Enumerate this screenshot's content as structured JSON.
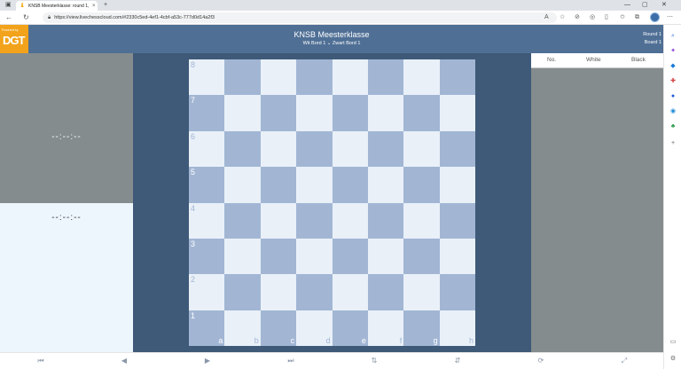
{
  "browser": {
    "tab_title": "KNSB Meesterklasse: round 1, g...",
    "tab_close": "×",
    "new_tab": "+",
    "url": "https://view.livechesscloud.com/#2330c5ed-4ef1-4cbf-a53c-777d0d14a2f3"
  },
  "app": {
    "logo_powered": "Powered by",
    "logo_text": "DGT",
    "title": "KNSB Meesterklasse",
    "subtitle": "Wit Bord 1 ⌄ Zwart Bord 1",
    "round": "Round 1",
    "board": "Board 1"
  },
  "clocks": {
    "top": "--:--:--",
    "bottom": "--:--:--"
  },
  "moves": {
    "headers": [
      "No.",
      "White",
      "Black"
    ]
  },
  "board": {
    "ranks": [
      "8",
      "7",
      "6",
      "5",
      "4",
      "3",
      "2",
      "1"
    ],
    "files": [
      "a",
      "b",
      "c",
      "d",
      "e",
      "f",
      "g",
      "h"
    ],
    "light_color": "#e9f0f8",
    "dark_color": "#a2b6d4"
  },
  "colors": {
    "header": "#4f6f95",
    "board_bg": "#3e5a78",
    "logo": "#f2a31b",
    "panel_grey": "#858c8d"
  }
}
